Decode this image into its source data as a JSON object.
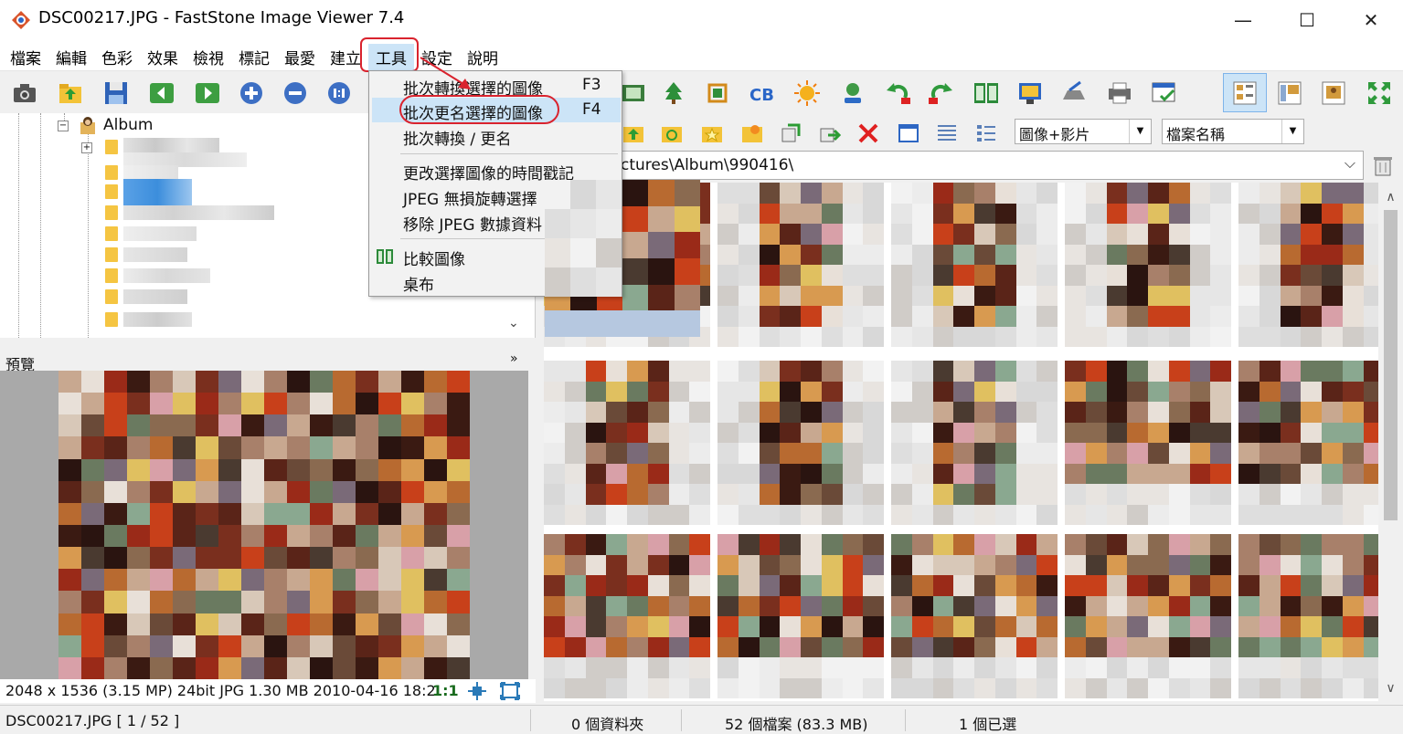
{
  "window": {
    "title": "DSC00217.JPG  -  FastStone Image Viewer 7.4",
    "minimize": "—",
    "maximize": "☐",
    "close": "✕"
  },
  "menubar": {
    "items": [
      "檔案",
      "編輯",
      "色彩",
      "效果",
      "檢視",
      "標記",
      "最愛",
      "建立",
      "工具",
      "設定",
      "說明"
    ],
    "active": "工具"
  },
  "tools_menu": {
    "items": [
      {
        "label": "批次轉換選擇的圖像",
        "key": "F3"
      },
      {
        "label": "批次更名選擇的圖像",
        "key": "F4"
      },
      {
        "label": "批次轉換 / 更名",
        "key": ""
      },
      {
        "label": "更改選擇圖像的時間戳記",
        "key": ""
      },
      {
        "label": "JPEG 無損旋轉選擇",
        "key": ""
      },
      {
        "label": "移除 JPEG 數據資料",
        "key": ""
      },
      {
        "label": "比較圖像",
        "key": ""
      },
      {
        "label": "桌布",
        "key": ""
      }
    ],
    "highlighted_index": 1
  },
  "tree": {
    "root_label": "Album"
  },
  "address": {
    "path": "ctures\\Album\\990416\\"
  },
  "filters": {
    "type_value": "圖像+影片",
    "sort_value": "檔案名稱"
  },
  "preview": {
    "label": "預覽",
    "info": "2048 x 1536 (3.15 MP)  24bit  JPG   1.30 MB   2010-04-16 18:2",
    "zoom": "1:1"
  },
  "statusbar": {
    "file": "DSC00217.JPG [ 1 / 52 ]",
    "folders": "0 個資料夾",
    "files": "52 個檔案 (83.3 MB)",
    "selected": "1 個已選"
  },
  "colors": {
    "highlight_red": "#d9232e",
    "menu_hover": "#cce4f7"
  }
}
